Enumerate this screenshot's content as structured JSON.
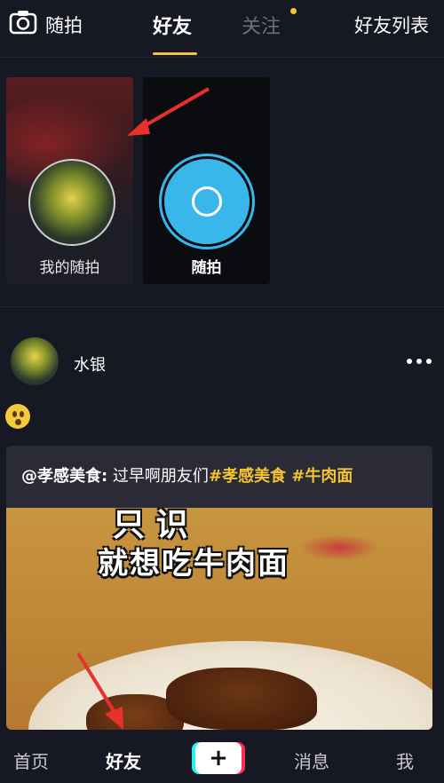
{
  "topnav": {
    "camera_label": "随拍",
    "tab_friends": "好友",
    "tab_follow": "关注",
    "friend_list": "好友列表"
  },
  "stories": {
    "mine_label": "我的随拍",
    "snap_label": "随拍"
  },
  "post": {
    "username": "水银",
    "share_author": "@孝感美食:",
    "share_text": " 过早啊朋友们",
    "tag1": "#孝感美食",
    "tag2": " #牛肉面",
    "video_caption_top": "只 识",
    "video_caption": "就想吃牛肉面"
  },
  "bottomnav": {
    "home": "首页",
    "friends": "好友",
    "plus": "+",
    "messages": "消息",
    "me": "我"
  },
  "colors": {
    "accent_yellow": "#f6c430",
    "background": "#161823",
    "capture_blue": "#3ab7ea"
  }
}
